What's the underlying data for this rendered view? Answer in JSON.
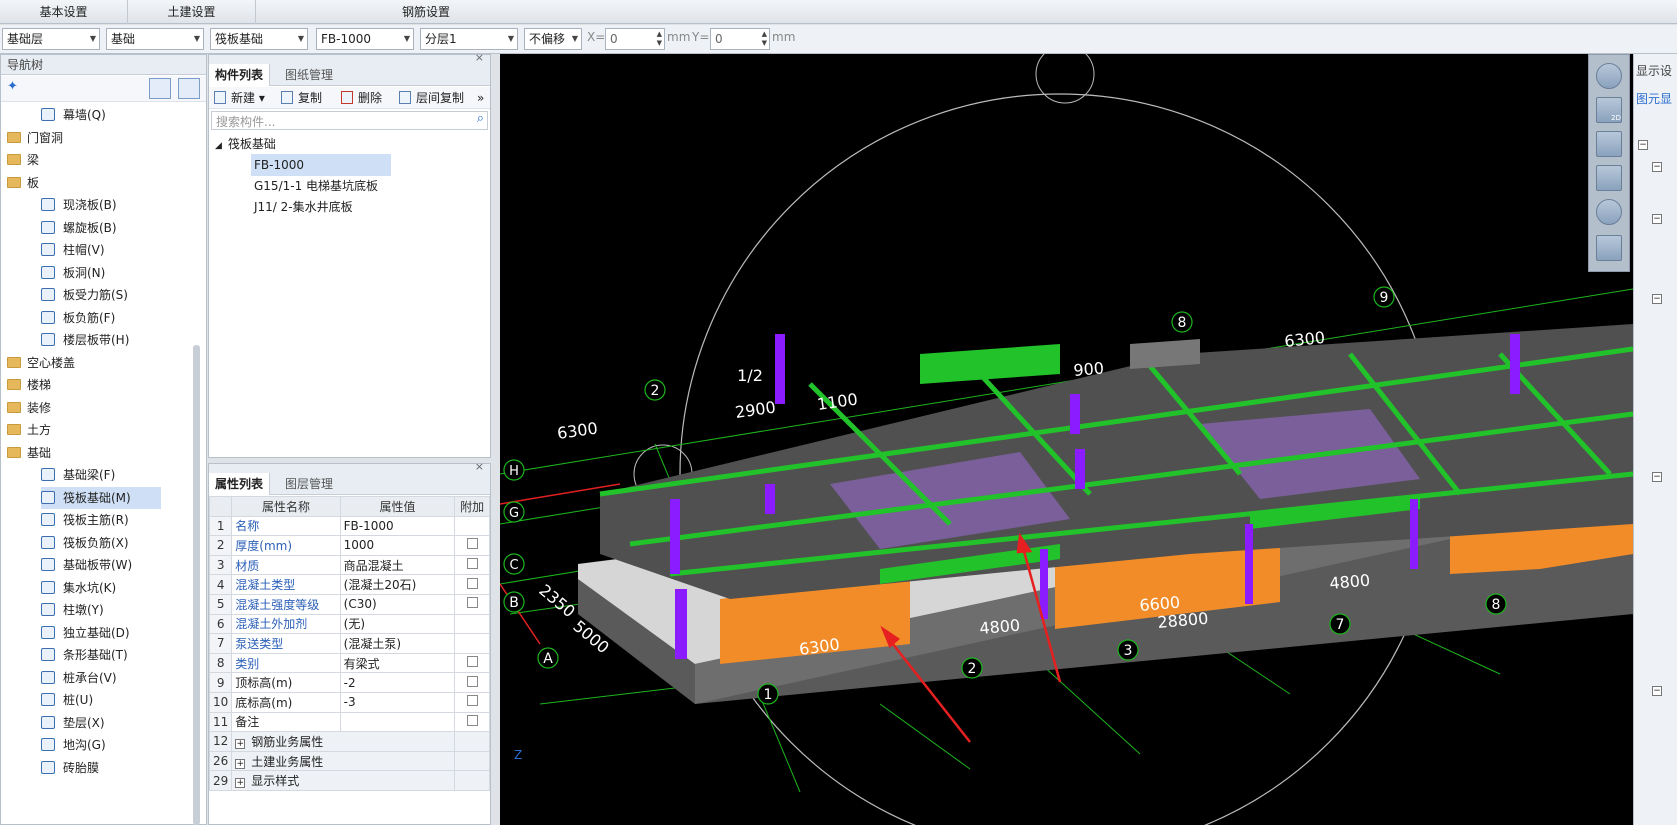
{
  "menubar": {
    "items": [
      "基本设置",
      "土建设置",
      "钢筋设置"
    ]
  },
  "toolbar": {
    "combos": [
      "基础层",
      "基础",
      "筏板基础",
      "FB-1000",
      "分层1",
      "不偏移"
    ],
    "x_label": "X=",
    "x_value": "0",
    "mm1": "mm",
    "y_label": "Y=",
    "y_value": "0",
    "mm2": "mm"
  },
  "nav": {
    "title": "导航树",
    "items": [
      {
        "label": "幕墙(Q)",
        "type": "item",
        "indent": 2
      },
      {
        "label": "门窗洞",
        "type": "folder"
      },
      {
        "label": "梁",
        "type": "folder"
      },
      {
        "label": "板",
        "type": "folder"
      },
      {
        "label": "现浇板(B)",
        "type": "item",
        "indent": 2
      },
      {
        "label": "螺旋板(B)",
        "type": "item",
        "indent": 2
      },
      {
        "label": "柱帽(V)",
        "type": "item",
        "indent": 2
      },
      {
        "label": "板洞(N)",
        "type": "item",
        "indent": 2
      },
      {
        "label": "板受力筋(S)",
        "type": "item",
        "indent": 2
      },
      {
        "label": "板负筋(F)",
        "type": "item",
        "indent": 2
      },
      {
        "label": "楼层板带(H)",
        "type": "item",
        "indent": 2
      },
      {
        "label": "空心楼盖",
        "type": "folder"
      },
      {
        "label": "楼梯",
        "type": "folder"
      },
      {
        "label": "装修",
        "type": "folder"
      },
      {
        "label": "土方",
        "type": "folder"
      },
      {
        "label": "基础",
        "type": "folder"
      },
      {
        "label": "基础梁(F)",
        "type": "item",
        "indent": 2
      },
      {
        "label": "筏板基础(M)",
        "type": "item",
        "indent": 2,
        "selected": true
      },
      {
        "label": "筏板主筋(R)",
        "type": "item",
        "indent": 2
      },
      {
        "label": "筏板负筋(X)",
        "type": "item",
        "indent": 2
      },
      {
        "label": "基础板带(W)",
        "type": "item",
        "indent": 2
      },
      {
        "label": "集水坑(K)",
        "type": "item",
        "indent": 2
      },
      {
        "label": "柱墩(Y)",
        "type": "item",
        "indent": 2
      },
      {
        "label": "独立基础(D)",
        "type": "item",
        "indent": 2
      },
      {
        "label": "条形基础(T)",
        "type": "item",
        "indent": 2
      },
      {
        "label": "桩承台(V)",
        "type": "item",
        "indent": 2
      },
      {
        "label": "桩(U)",
        "type": "item",
        "indent": 2
      },
      {
        "label": "垫层(X)",
        "type": "item",
        "indent": 2
      },
      {
        "label": "地沟(G)",
        "type": "item",
        "indent": 2
      },
      {
        "label": "砖胎膜",
        "type": "item",
        "indent": 2
      }
    ]
  },
  "components": {
    "tabs": [
      "构件列表",
      "图纸管理"
    ],
    "buttons": [
      "新建",
      "复制",
      "删除",
      "层间复制"
    ],
    "search_placeholder": "搜索构件...",
    "group": "筏板基础",
    "items": [
      "FB-1000",
      "G15/1-1 电梯基坑底板",
      "J11/ 2-集水井底板"
    ]
  },
  "properties": {
    "tabs": [
      "属性列表",
      "图层管理"
    ],
    "headers": [
      "属性名称",
      "属性值",
      "附加"
    ],
    "rows": [
      {
        "idx": "1",
        "name": "名称",
        "value": "FB-1000",
        "blue": true,
        "check": false
      },
      {
        "idx": "2",
        "name": "厚度(mm)",
        "value": "1000",
        "blue": true,
        "check": true
      },
      {
        "idx": "3",
        "name": "材质",
        "value": "商品混凝土",
        "blue": true,
        "check": true
      },
      {
        "idx": "4",
        "name": "混凝土类型",
        "value": "(混凝土20石)",
        "blue": true,
        "check": true
      },
      {
        "idx": "5",
        "name": "混凝土强度等级",
        "value": "(C30)",
        "blue": true,
        "check": true
      },
      {
        "idx": "6",
        "name": "混凝土外加剂",
        "value": "(无)",
        "blue": true,
        "check": false
      },
      {
        "idx": "7",
        "name": "泵送类型",
        "value": "(混凝土泵)",
        "blue": true,
        "check": false
      },
      {
        "idx": "8",
        "name": "类别",
        "value": "有梁式",
        "blue": true,
        "check": true
      },
      {
        "idx": "9",
        "name": "顶标高(m)",
        "value": "-2",
        "blue": false,
        "check": true
      },
      {
        "idx": "10",
        "name": "底标高(m)",
        "value": "-3",
        "blue": false,
        "check": true
      },
      {
        "idx": "11",
        "name": "备注",
        "value": "",
        "blue": false,
        "check": true
      }
    ],
    "groups": [
      {
        "idx": "12",
        "name": "钢筋业务属性"
      },
      {
        "idx": "26",
        "name": "土建业务属性"
      },
      {
        "idx": "29",
        "name": "显示样式"
      }
    ]
  },
  "viewport": {
    "dims": [
      "6300",
      "2900",
      "1100",
      "6300",
      "4800",
      "6600",
      "28800",
      "6300",
      "5000",
      "2350",
      "4800",
      "900"
    ],
    "axes": [
      "2",
      "1/2",
      "8",
      "9",
      "A",
      "B",
      "1",
      "2",
      "3",
      "7",
      "8"
    ],
    "side_letters": [
      "H",
      "G",
      "C"
    ],
    "mini_2d": "2D"
  },
  "right_panel": {
    "title": "显示设",
    "sub": "图元显"
  }
}
